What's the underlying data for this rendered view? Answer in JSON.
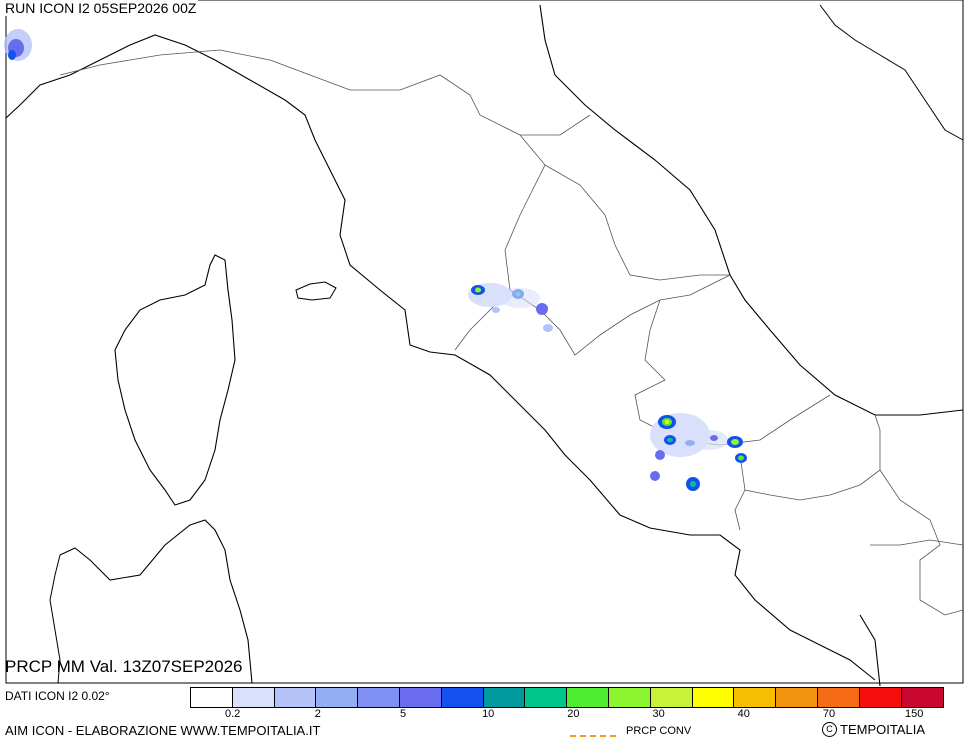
{
  "header": {
    "run_title": "RUN ICON I2 05SEP2026 00Z"
  },
  "footer": {
    "field_title": "PRCP MM Val. 13Z07SEP2026",
    "data_source": "DATI ICON I2 0.02°",
    "credit": "AIM ICON - ELABORAZIONE WWW.TEMPOITALIA.IT",
    "conv_label": "PRCP CONV",
    "copyright_symbol": "C",
    "copyright": "TEMPOITALIA"
  },
  "legend": {
    "colors": [
      "#ffffff",
      "#d9e0fb",
      "#b3c3f8",
      "#93aef5",
      "#7f8ff2",
      "#6a6cee",
      "#1450f0",
      "#009a9e",
      "#00c68c",
      "#50ec32",
      "#8cf530",
      "#c7f237",
      "#ffff00",
      "#f7bd00",
      "#f59411",
      "#f56b16",
      "#f50e0b",
      "#c9082f"
    ],
    "ticks": [
      "0.2",
      "2",
      "5",
      "10",
      "20",
      "30",
      "40",
      "70",
      "150"
    ]
  },
  "map": {
    "coastline_color": "#000000",
    "border_color": "#333333",
    "precip_cells": [
      {
        "name": "cell-nw-corner",
        "value": 5,
        "color": "#7f8ff2"
      },
      {
        "name": "cell-umbria-1",
        "value": 30,
        "color": "#8cf530"
      },
      {
        "name": "cell-umbria-2",
        "value": 10,
        "color": "#1450f0"
      },
      {
        "name": "cell-umbria-3",
        "value": 5,
        "color": "#6a6cee"
      },
      {
        "name": "cell-lazio-1",
        "value": 40,
        "color": "#ffff00"
      },
      {
        "name": "cell-lazio-2",
        "value": 20,
        "color": "#00c68c"
      },
      {
        "name": "cell-campania-1",
        "value": 30,
        "color": "#8cf530"
      },
      {
        "name": "cell-campania-2",
        "value": 20,
        "color": "#50ec32"
      },
      {
        "name": "cell-campania-3",
        "value": 10,
        "color": "#1450f0"
      },
      {
        "name": "cell-campania-4",
        "value": 20,
        "color": "#00c68c"
      }
    ]
  }
}
